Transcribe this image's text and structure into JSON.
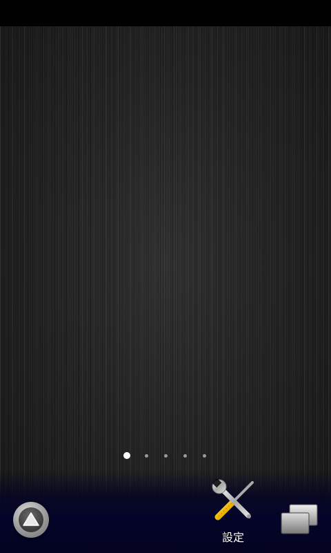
{
  "status_bar": {},
  "wallpaper": {
    "style": "brushed-dark-metal"
  },
  "page_indicator": {
    "pages": 5,
    "current": 1
  },
  "dock": {
    "launcher_icon": "triangle-up-icon",
    "apps": [
      {
        "label": "設定",
        "icon": "wrench-screwdriver-icon"
      }
    ],
    "recent_icon": "recent-apps-icon"
  },
  "colors": {
    "dock_bg": "#03031f",
    "wallpaper_base": "#232323",
    "indicator_active": "#ffffff",
    "indicator_inactive": "#9a9a9a",
    "wrench_handle": "#f2b705"
  }
}
